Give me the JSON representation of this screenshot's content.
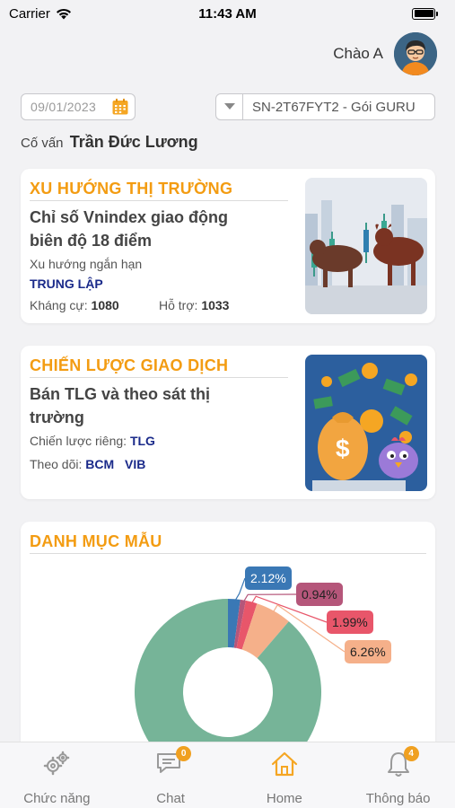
{
  "status_bar": {
    "carrier": "Carrier",
    "time": "11:43 AM"
  },
  "header": {
    "greeting": "Chào A"
  },
  "filters": {
    "date": "09/01/2023",
    "package": "SN-2T67FYT2 - Gói GURU"
  },
  "advisor": {
    "prefix": "Cố vấn",
    "name": "Trần Đức Lương"
  },
  "market_trend": {
    "title": "XU HƯỚNG THỊ TRƯỜNG",
    "headline_line1": "Chỉ số Vnindex giao động",
    "headline_line2": "biên độ 18 điểm",
    "subtitle": "Xu hướng ngắn hạn",
    "trend_value": "TRUNG LẬP",
    "resistance_label": "Kháng cự:",
    "resistance_value": "1080",
    "support_label": "Hỗ trợ:",
    "support_value": "1033"
  },
  "trading_strategy": {
    "title": "CHIẾN LƯỢC GIAO DỊCH",
    "headline_line1": "Bán TLG và theo sát thị",
    "headline_line2": "trường",
    "private_label": "Chiến lược riêng:",
    "private_value": "TLG",
    "watch_label": "Theo dõi:",
    "watch_1": "BCM",
    "watch_2": "VIB"
  },
  "portfolio": {
    "title": "DANH MỤC MẪU",
    "slice_labels": [
      "2.12%",
      "0.94%",
      "1.99%",
      "6.26%"
    ]
  },
  "chart_data": {
    "type": "pie",
    "title": "DANH MỤC MẪU",
    "values": [
      2.12,
      0.94,
      1.99,
      6.26,
      88.69
    ],
    "slice_colors": [
      "#3a78b5",
      "#b5567a",
      "#e8566a",
      "#f5b08a",
      "#76b498"
    ]
  },
  "tabs": [
    {
      "label": "Chức năng",
      "icon": "gears-icon"
    },
    {
      "label": "Chat",
      "icon": "chat-icon",
      "badge": "0"
    },
    {
      "label": "Home",
      "icon": "home-icon"
    },
    {
      "label": "Thông báo",
      "icon": "bell-icon",
      "badge": "4"
    }
  ],
  "colors": {
    "accent": "#f39c12",
    "tag": "#1a2a8a",
    "home_active": "#f5a623"
  }
}
